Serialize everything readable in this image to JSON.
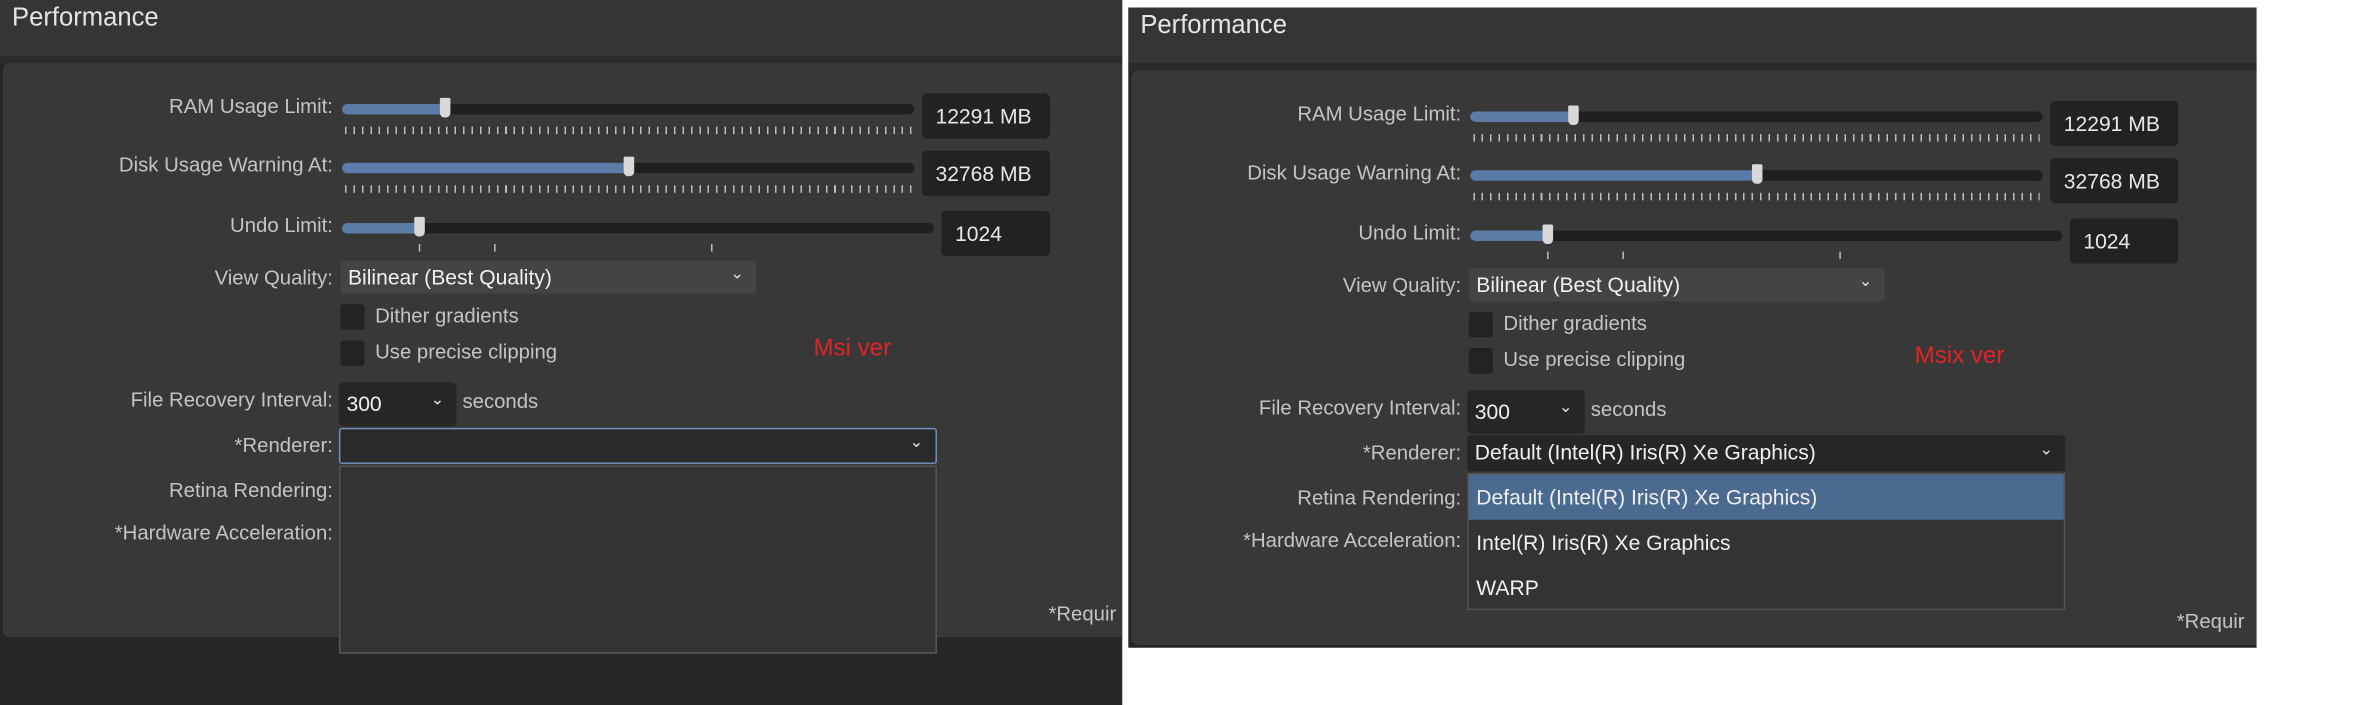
{
  "left": {
    "title": "Performance",
    "ram": {
      "label": "RAM Usage Limit:",
      "value": "12291 MB",
      "fraction": 0.18
    },
    "disk": {
      "label": "Disk Usage Warning At:",
      "value": "32768 MB",
      "fraction": 0.5
    },
    "undo": {
      "label": "Undo Limit:",
      "value": "1024",
      "fraction": 0.13
    },
    "view_quality": {
      "label": "View Quality:",
      "value": "Bilinear (Best Quality)"
    },
    "dither": {
      "label": "Dither gradients",
      "checked": false
    },
    "precise": {
      "label": "Use precise clipping",
      "checked": false
    },
    "recovery": {
      "label": "File Recovery Interval:",
      "value": "300",
      "unit": "seconds"
    },
    "renderer": {
      "label": "*Renderer:",
      "value": "",
      "options": []
    },
    "retina": {
      "label": "Retina Rendering:"
    },
    "hw": {
      "label": "*Hardware Acceleration:"
    },
    "required_note": "*Requir",
    "annotation": "Msi ver"
  },
  "right": {
    "title": "Performance",
    "ram": {
      "label": "RAM Usage Limit:",
      "value": "12291 MB",
      "fraction": 0.18
    },
    "disk": {
      "label": "Disk Usage Warning At:",
      "value": "32768 MB",
      "fraction": 0.5
    },
    "undo": {
      "label": "Undo Limit:",
      "value": "1024",
      "fraction": 0.13
    },
    "view_quality": {
      "label": "View Quality:",
      "value": "Bilinear (Best Quality)"
    },
    "dither": {
      "label": "Dither gradients",
      "checked": false
    },
    "precise": {
      "label": "Use precise clipping",
      "checked": false
    },
    "recovery": {
      "label": "File Recovery Interval:",
      "value": "300",
      "unit": "seconds"
    },
    "renderer": {
      "label": "*Renderer:",
      "value": "Default (Intel(R) Iris(R) Xe Graphics)",
      "options": [
        "Default (Intel(R) Iris(R) Xe Graphics)",
        "Intel(R) Iris(R) Xe Graphics",
        "WARP"
      ],
      "selected_index": 0
    },
    "retina": {
      "label": "Retina Rendering:"
    },
    "hw": {
      "label": "*Hardware Acceleration:"
    },
    "required_note": "*Requir",
    "annotation": "Msix ver"
  },
  "colors": {
    "accent": "#5a7ca6",
    "highlight": "#4a6a8f",
    "annotation": "#e02424"
  }
}
